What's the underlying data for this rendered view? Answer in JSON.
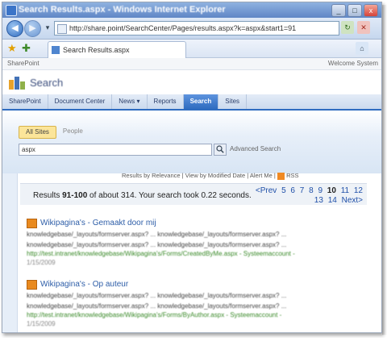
{
  "window": {
    "title": "Search Results.aspx - Windows Internet Explorer",
    "buttons": [
      "_",
      "□",
      "x"
    ]
  },
  "browser": {
    "address": "http://share.point/SearchCenter/Pages/results.aspx?k=aspx&start1=91",
    "tab_label": "Search Results.aspx"
  },
  "sharepoint": {
    "top_left": "SharePoint",
    "top_right": "Welcome System",
    "site_title": "Search",
    "nav": [
      "SharePoint",
      "Document Center",
      "News ▾",
      "Reports",
      "Search",
      "Sites"
    ],
    "active_nav": "Search"
  },
  "search": {
    "scopes": [
      "All Sites",
      "People"
    ],
    "query": "aspx",
    "advanced": "Advanced Search"
  },
  "results_header": {
    "sort_relevance": "Results by Relevance",
    "sep1": "|",
    "sort_date": "View by Modified Date",
    "sep2": "|",
    "alert": "Alert Me",
    "sep3": "|",
    "rss": "RSS"
  },
  "summary": {
    "prefix": "Results ",
    "range": "91-100",
    "middle": " of about 314. Your search took 0.22 seconds."
  },
  "pager": {
    "prev": "<Prev",
    "pages": [
      "5",
      "6",
      "7",
      "8",
      "9",
      "10",
      "11",
      "12",
      "13",
      "14"
    ],
    "current": "10",
    "next": "Next>"
  },
  "results": [
    {
      "title": "Wikipagina's - Gemaakt door mij",
      "snippet1": "knowledgebase/_layouts/formserver.aspx? ... knowledgebase/_layouts/formserver.aspx? ...",
      "snippet2": "knowledgebase/_layouts/formserver.aspx? ... knowledgebase/_layouts/formserver.aspx? ...",
      "url": "http://test.intranet/knowledgebase/Wikipagina's/Forms/CreatedByMe.aspx - Systeemaccount -",
      "date": "1/15/2009"
    },
    {
      "title": "Wikipagina's - Op auteur",
      "snippet1": "knowledgebase/_layouts/formserver.aspx? ... knowledgebase/_layouts/formserver.aspx? ...",
      "snippet2": "knowledgebase/_layouts/formserver.aspx? ... knowledgebase/_layouts/formserver.aspx? ...",
      "url": "http://test.intranet/knowledgebase/Wikipagina's/Forms/ByAuthor.aspx - Systeemaccount -",
      "date": "1/15/2009"
    }
  ]
}
